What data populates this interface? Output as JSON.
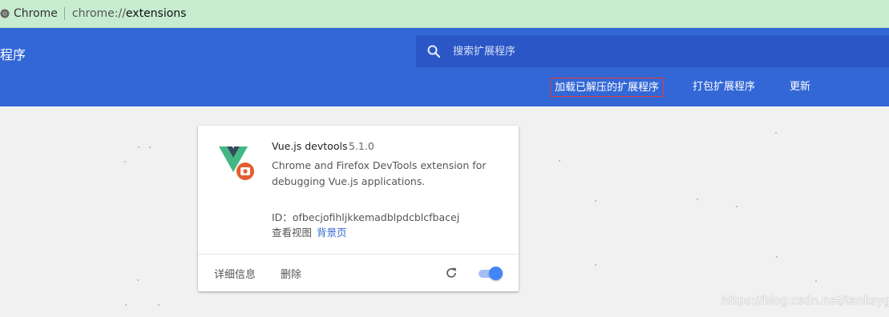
{
  "browser": {
    "app_name": "Chrome",
    "url_scheme": "chrome://",
    "url_host": "extensions"
  },
  "header": {
    "title": "扩展程序",
    "title_visible": "程序",
    "search_placeholder": "搜索扩展程序",
    "actions": {
      "load_unpacked": "加载已解压的扩展程序",
      "pack_extension": "打包扩展程序",
      "update": "更新"
    },
    "colors": {
      "header_bg": "#3367d6",
      "search_bg": "#2a56c6"
    }
  },
  "extension_card": {
    "name": "Vue.js devtools",
    "version": "5.1.0",
    "description": "Chrome and Firefox DevTools extension for debugging Vue.js applications.",
    "id_label": "ID：",
    "id_value": "ofbecjofihljkkemadblpdcblcfbacej",
    "inspect_views_label": "查看视图",
    "inspect_link": "背景页",
    "details_label": "详细信息",
    "remove_label": "删除",
    "enabled": true,
    "icons": {
      "logo": "vue-logo-icon",
      "reload": "reload-icon"
    }
  },
  "watermark": "https://blog.csdn.net/tanksyg"
}
